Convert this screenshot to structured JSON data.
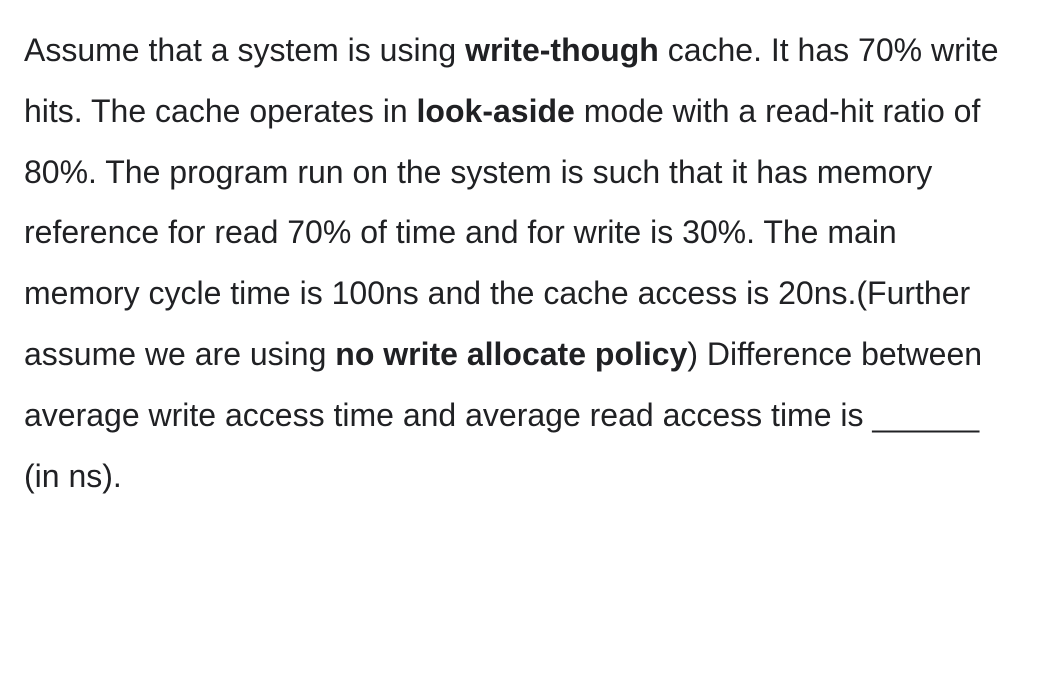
{
  "text": {
    "s1": "Assume that a system is using ",
    "b1": "write-though",
    "s2": " cache. It has 70% write hits. The cache operates in ",
    "b2": "look-aside",
    "s3": " mode with a read-hit ratio of 80%. The program run on the system is such that it has memory reference for read 70% of time and for write is 30%. The main memory cycle time is 100ns and the cache access is 20ns.(Further assume we are using ",
    "b3": "no write allocate policy",
    "s4": ") Difference between average write access time and average read access time is ",
    "blank": "______",
    "s5": " (in ns)."
  }
}
